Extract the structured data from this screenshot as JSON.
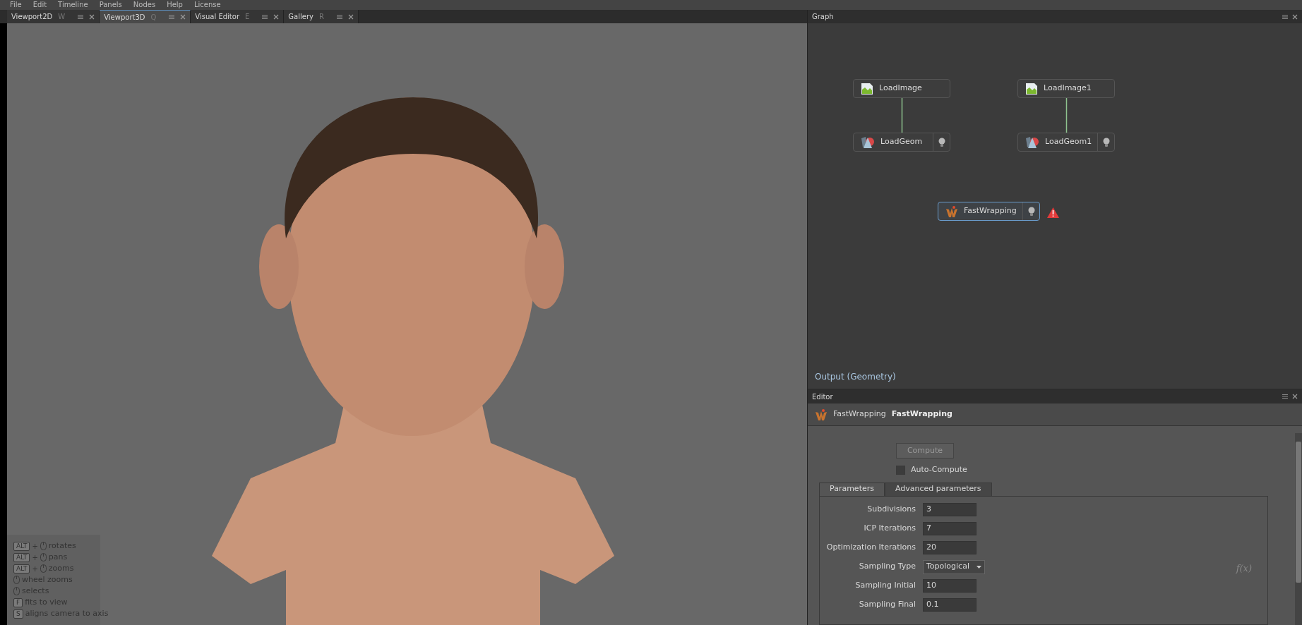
{
  "menu": [
    "File",
    "Edit",
    "Timeline",
    "Panels",
    "Nodes",
    "Help",
    "License"
  ],
  "tabs": [
    {
      "label": "Viewport2D",
      "shortcut": "W",
      "selected": false
    },
    {
      "label": "Viewport3D",
      "shortcut": "Q",
      "selected": true
    },
    {
      "label": "Visual Editor",
      "shortcut": "E",
      "selected": false
    },
    {
      "label": "Gallery",
      "shortcut": "R",
      "selected": false
    }
  ],
  "hints": [
    {
      "kind": "combo",
      "key": "ALT",
      "plus": "+",
      "text": "rotates"
    },
    {
      "kind": "combo",
      "key": "ALT",
      "plus": "+",
      "text": "pans"
    },
    {
      "kind": "combo",
      "key": "ALT",
      "plus": "+",
      "text": "zooms"
    },
    {
      "kind": "mouse",
      "text": "wheel zooms"
    },
    {
      "kind": "mouse",
      "text": "selects"
    },
    {
      "kind": "key",
      "key": "F",
      "text": "fits to view"
    },
    {
      "kind": "key",
      "key": "S",
      "text": "aligns camera to axis"
    }
  ],
  "graph": {
    "title": "Graph",
    "nodes": [
      {
        "label": "LoadImage",
        "kind": "image",
        "selected": false,
        "warning": false
      },
      {
        "label": "LoadImage1",
        "kind": "image",
        "selected": false,
        "warning": false
      },
      {
        "label": "LoadGeom",
        "kind": "geom",
        "selected": false,
        "warning": false
      },
      {
        "label": "LoadGeom1",
        "kind": "geom",
        "selected": false,
        "warning": false
      },
      {
        "label": "FastWrapping",
        "kind": "wrap",
        "selected": true,
        "warning": true
      }
    ],
    "output_label": "Output (Geometry)"
  },
  "editor": {
    "title": "Editor",
    "node_type": "FastWrapping",
    "node_name": "FastWrapping",
    "compute": {
      "label": "Compute",
      "disabled": true
    },
    "auto_compute": {
      "label": "Auto-Compute",
      "checked": false
    },
    "tabs": [
      {
        "label": "Parameters",
        "selected": true
      },
      {
        "label": "Advanced parameters",
        "selected": false
      }
    ],
    "params": [
      {
        "label": "Subdivisions",
        "kind": "input",
        "value": "3"
      },
      {
        "label": "ICP Iterations",
        "kind": "input",
        "value": "7"
      },
      {
        "label": "Optimization Iterations",
        "kind": "input",
        "value": "20"
      },
      {
        "label": "Sampling Type",
        "kind": "dropdown",
        "value": "Topological"
      },
      {
        "label": "Sampling Initial",
        "kind": "input",
        "value": "10"
      },
      {
        "label": "Sampling Final",
        "kind": "input",
        "value": "0.1"
      }
    ],
    "fx": "f(x)"
  }
}
